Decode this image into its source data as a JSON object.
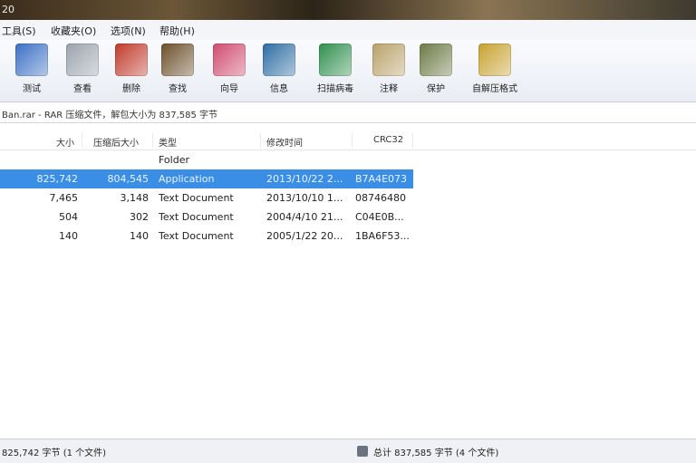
{
  "window": {
    "title": "20"
  },
  "menu": [
    "工具(S)",
    "收藏夹(O)",
    "选项(N)",
    "帮助(H)"
  ],
  "toolbar": [
    {
      "label": "测试",
      "icon": "test-icon",
      "color": "#3a6fc4"
    },
    {
      "label": "查看",
      "icon": "view-icon",
      "color": "#9aa3ad"
    },
    {
      "label": "删除",
      "icon": "delete-icon",
      "color": "#c0392b"
    },
    {
      "label": "查找",
      "icon": "find-icon",
      "color": "#6b4f2a"
    },
    {
      "label": "向导",
      "icon": "wizard-icon",
      "color": "#d04b6e"
    },
    {
      "label": "信息",
      "icon": "info-icon",
      "color": "#2d6da3"
    },
    {
      "label": "扫描病毒",
      "icon": "virus-scan-icon",
      "color": "#2f8f4e"
    },
    {
      "label": "注释",
      "icon": "comment-icon",
      "color": "#b9a26a"
    },
    {
      "label": "保护",
      "icon": "protect-icon",
      "color": "#6d7a45"
    },
    {
      "label": "自解压格式",
      "icon": "sfx-icon",
      "color": "#c8a230"
    }
  ],
  "address": "Ban.rar - RAR 压缩文件，解包大小为 837,585 字节",
  "columns": [
    "大小",
    "压缩后大小",
    "类型",
    "修改时间",
    "CRC32"
  ],
  "files": [
    {
      "size": "",
      "packed": "",
      "type": "Folder",
      "modified": "",
      "crc": ""
    },
    {
      "size": "825,742",
      "packed": "804,545",
      "type": "Application",
      "modified": "2013/10/22 2...",
      "crc": "B7A4E073",
      "selected": true
    },
    {
      "size": "7,465",
      "packed": "3,148",
      "type": "Text Document",
      "modified": "2013/10/10 1...",
      "crc": "08746480"
    },
    {
      "size": "504",
      "packed": "302",
      "type": "Text Document",
      "modified": "2004/4/10 21...",
      "crc": "C04E0B..."
    },
    {
      "size": "140",
      "packed": "140",
      "type": "Text Document",
      "modified": "2005/1/22 20...",
      "crc": "1BA6F53..."
    }
  ],
  "status": {
    "left": "825,742 字节 (1 个文件)",
    "right": "总计 837,585 字节 (4 个文件)"
  }
}
